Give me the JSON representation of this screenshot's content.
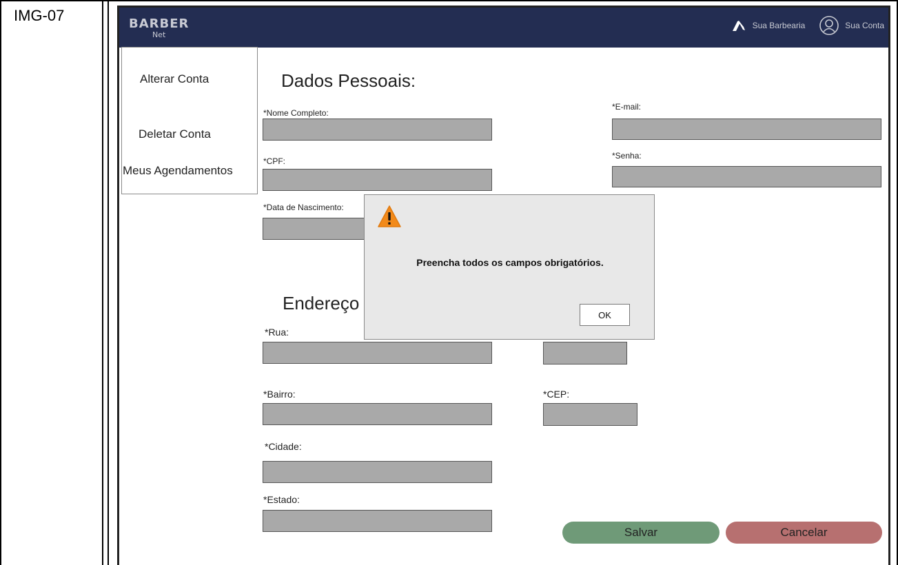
{
  "doc": {
    "id_label": "IMG-07"
  },
  "navbar": {
    "logo_line1": "BARBER",
    "logo_line2": "Net",
    "barbershop_label": "Sua Barbearia",
    "account_label": "Sua Conta",
    "icons": [
      "razor-icon",
      "user-circle-icon"
    ]
  },
  "sidebar": {
    "items": [
      {
        "label": "Alterar Conta"
      },
      {
        "label": "Deletar Conta"
      },
      {
        "label": "Meus Agendamentos"
      }
    ]
  },
  "personal": {
    "title": "Dados Pessoais:",
    "name_label": "*Nome Completo:",
    "cpf_label": "*CPF:",
    "birth_label": "*Data de Nascimento:",
    "email_label": "*E-mail:",
    "password_label": "*Senha:"
  },
  "address": {
    "title": "Endereço",
    "street_label": "*Rua:",
    "district_label": "*Bairro:",
    "cep_label": "*CEP:",
    "city_label": "*Cidade:",
    "state_label": "*Estado:"
  },
  "actions": {
    "save": "Salvar",
    "cancel": "Cancelar"
  },
  "modal": {
    "message": "Preencha todos os campos obrigatórios.",
    "ok": "OK",
    "icon": "warning-icon"
  },
  "colors": {
    "navbar": "#232d52",
    "field": "#a9a9a9",
    "save": "#6f9a78",
    "cancel": "#b77070",
    "warning": "#f28a1a"
  }
}
